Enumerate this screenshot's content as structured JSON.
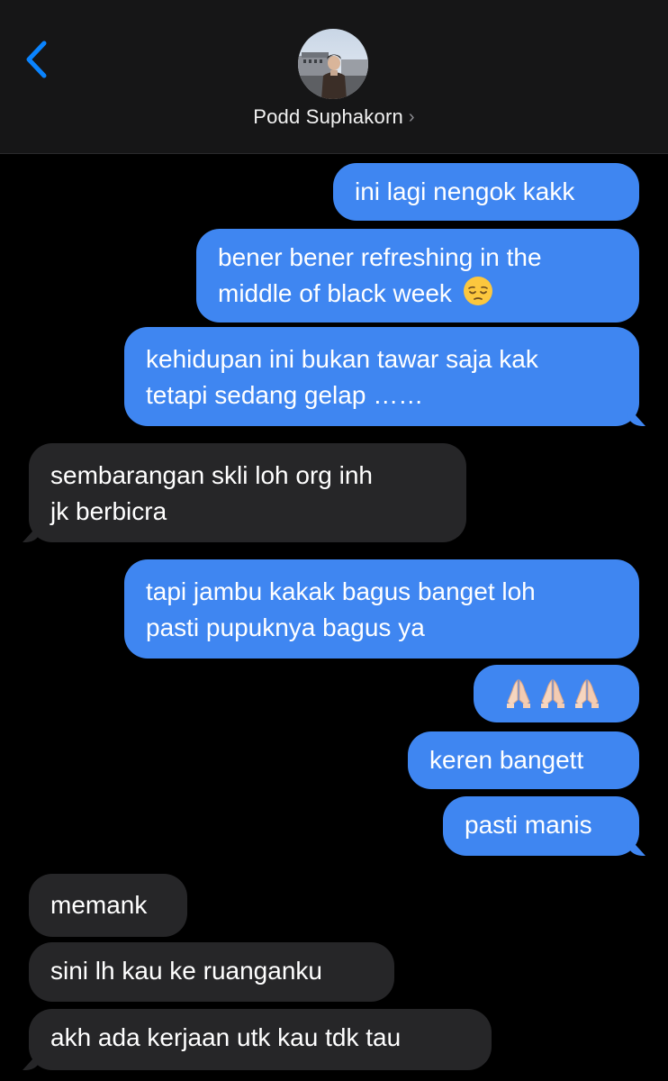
{
  "header": {
    "back_icon": "chevron-left-icon",
    "contact_name": "Podd Suphakorn",
    "contact_chevron": "›",
    "avatar_icon": "contact-photo"
  },
  "colors": {
    "sent_bubble": "#3f86f1",
    "received_bubble": "#262628",
    "accent": "#0a84ff"
  },
  "messages": [
    {
      "side": "sent",
      "text": "ini lagi nengok kakk"
    },
    {
      "side": "sent",
      "lines": [
        "bener bener refreshing in the",
        "middle of black week"
      ],
      "emoji": "pensive-face"
    },
    {
      "side": "sent",
      "lines": [
        "kehidupan ini bukan tawar saja kak",
        "tetapi sedang gelap ……"
      ]
    },
    {
      "side": "received",
      "lines": [
        "sembarangan skli loh org inh",
        "jk berbicra"
      ]
    },
    {
      "side": "sent",
      "lines": [
        "tapi jambu kakak bagus banget loh",
        "pasti pupuknya bagus ya"
      ]
    },
    {
      "side": "sent",
      "emoji": "folded-hands x3"
    },
    {
      "side": "sent",
      "text": "keren bangett"
    },
    {
      "side": "sent",
      "text": "pasti manis"
    },
    {
      "side": "received",
      "text": "memank"
    },
    {
      "side": "received",
      "text": "sini lh kau ke ruanganku"
    },
    {
      "side": "received",
      "text": "akh ada kerjaan utk kau tdk tau"
    }
  ]
}
